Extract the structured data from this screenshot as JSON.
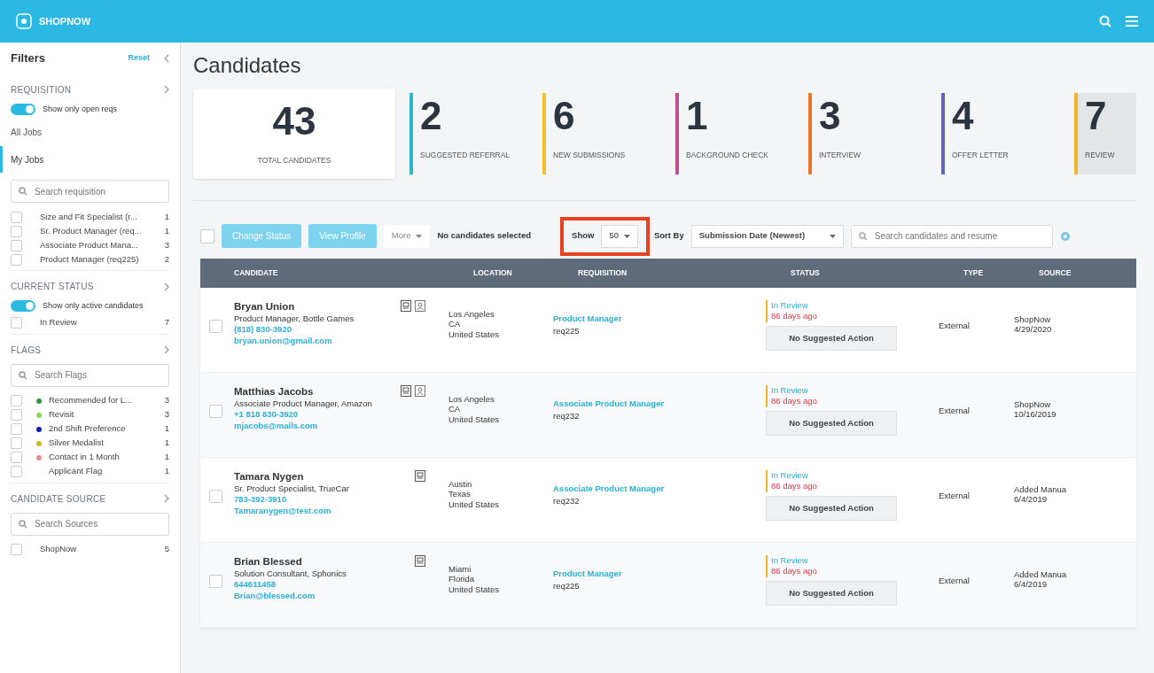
{
  "app": {
    "brand": "SHOPNOW"
  },
  "filters": {
    "title": "Filters",
    "reset": "Reset",
    "sections": [
      {
        "title": "REQUISITION",
        "toggle": {
          "label": "Show only open reqs",
          "on": true
        },
        "views": [
          {
            "label": "All Jobs",
            "selected": false
          },
          {
            "label": "My Jobs",
            "selected": true
          }
        ],
        "search": {
          "placeholder": "Search requisition"
        },
        "items": [
          {
            "label": "Size and Fit Specialist (r...",
            "count": "1",
            "checked": false
          },
          {
            "label": "Sr. Product Manager (req...",
            "count": "1",
            "checked": false
          },
          {
            "label": "Associate Product Mana...",
            "count": "3",
            "checked": false
          },
          {
            "label": "Product Manager (req225)",
            "count": "2",
            "checked": false
          }
        ]
      },
      {
        "title": "CURRENT STATUS",
        "toggle": {
          "label": "Show only active candidates",
          "on": true
        },
        "items": [
          {
            "label": "In Review",
            "count": "7",
            "checked": false
          }
        ]
      },
      {
        "title": "FLAGS",
        "search": {
          "placeholder": "Search Flags"
        },
        "items": [
          {
            "label": "Recommended for L...",
            "count": "3",
            "checked": false,
            "color": "#2e9a3c"
          },
          {
            "label": "Revisit",
            "count": "3",
            "checked": false,
            "color": "#8fd65a"
          },
          {
            "label": "2nd Shift Preference",
            "count": "1",
            "checked": false,
            "color": "#1518b8"
          },
          {
            "label": "Silver Medalist",
            "count": "1",
            "checked": false,
            "color": "#d8b526"
          },
          {
            "label": "Contact in 1 Month",
            "count": "1",
            "checked": false,
            "color": "#e88a94"
          },
          {
            "label": "Applicant Flag",
            "count": "1",
            "checked": false
          }
        ]
      },
      {
        "title": "CANDIDATE SOURCE",
        "search": {
          "placeholder": "Search Sources"
        },
        "items": [
          {
            "label": "ShopNow",
            "count": "5",
            "checked": false
          }
        ]
      }
    ]
  },
  "page_title": "Candidates",
  "stats": [
    {
      "value": "43",
      "label": "TOTAL CANDIDATES",
      "kind": "total"
    },
    {
      "value": "2",
      "label": "SUGGESTED REFERRAL",
      "color": "#2bb5c8"
    },
    {
      "value": "6",
      "label": "NEW SUBMISSIONS",
      "color": "#f2c02c"
    },
    {
      "value": "1",
      "label": "BACKGROUND CHECK",
      "color": "#c2508f"
    },
    {
      "value": "3",
      "label": "INTERVIEW",
      "color": "#ee7324"
    },
    {
      "value": "4",
      "label": "OFFER LETTER",
      "color": "#6166b3"
    },
    {
      "value": "7",
      "label": "REVIEW",
      "color": "#f0b429"
    }
  ],
  "toolbar": {
    "select_all": false,
    "change_status": "Change Status",
    "view_profile": "View Profile",
    "more": "More",
    "selection": "No candidates selected",
    "show_label": "Show",
    "show_value": "50",
    "show_highlighted": true,
    "sort_label": "Sort By",
    "sort_value": "Submission Date (Newest)",
    "search": {
      "placeholder": "Search candidates and resume"
    }
  },
  "table": {
    "columns": [
      "CANDIDATE",
      "LOCATION",
      "REQUISITION",
      "STATUS",
      "TYPE",
      "SOURCE"
    ],
    "rows": [
      {
        "name": "Bryan Union",
        "title": "Product Manager, Bottle Games",
        "phone": "(818) 830-3920",
        "email": "bryan.union@gmail.com",
        "resume": true,
        "profile": true,
        "location": [
          "Los Angeles",
          "CA",
          "United States"
        ],
        "requisition": "Product Manager",
        "req_id": "req225",
        "status": "In Review",
        "age": "86 days ago",
        "action": "No Suggested Action",
        "type": "External",
        "source": [
          "ShopNow",
          "4/29/2020"
        ],
        "checked": false
      },
      {
        "name": "Matthias Jacobs",
        "title": "Associate Product Manager, Amazon",
        "phone": "+1 818 830-3920",
        "email": "mjacobs@mails.com",
        "resume": true,
        "profile": true,
        "location": [
          "Los Angeles",
          "CA",
          "United States"
        ],
        "requisition": "Associate Product Manager",
        "req_id": "req232",
        "status": "In Review",
        "age": "86 days ago",
        "action": "No Suggested Action",
        "type": "External",
        "source": [
          "ShopNow",
          "10/16/2019"
        ],
        "checked": false
      },
      {
        "name": "Tamara Nygen",
        "title": "Sr. Product Specialist, TrueCar",
        "phone": "783-392-3910",
        "email": "Tamaranygen@test.com",
        "resume": true,
        "profile": false,
        "location": [
          "Austin",
          "Texas",
          "United States"
        ],
        "requisition": "Associate Product Manager",
        "req_id": "req232",
        "status": "In Review",
        "age": "86 days ago",
        "action": "No Suggested Action",
        "type": "External",
        "source": [
          "Added Manua",
          "6/4/2019"
        ],
        "checked": false
      },
      {
        "name": "Brian Blessed",
        "title": "Solution Consultant, Sphonics",
        "phone": "644611458",
        "email": "Brian@blessed.com",
        "resume": true,
        "profile": false,
        "location": [
          "Miami",
          "Florida",
          "United States"
        ],
        "requisition": "Product Manager",
        "req_id": "req225",
        "status": "In Review",
        "age": "86 days ago",
        "action": "No Suggested Action",
        "type": "External",
        "source": [
          "Added Manua",
          "6/4/2019"
        ],
        "checked": false
      }
    ]
  }
}
